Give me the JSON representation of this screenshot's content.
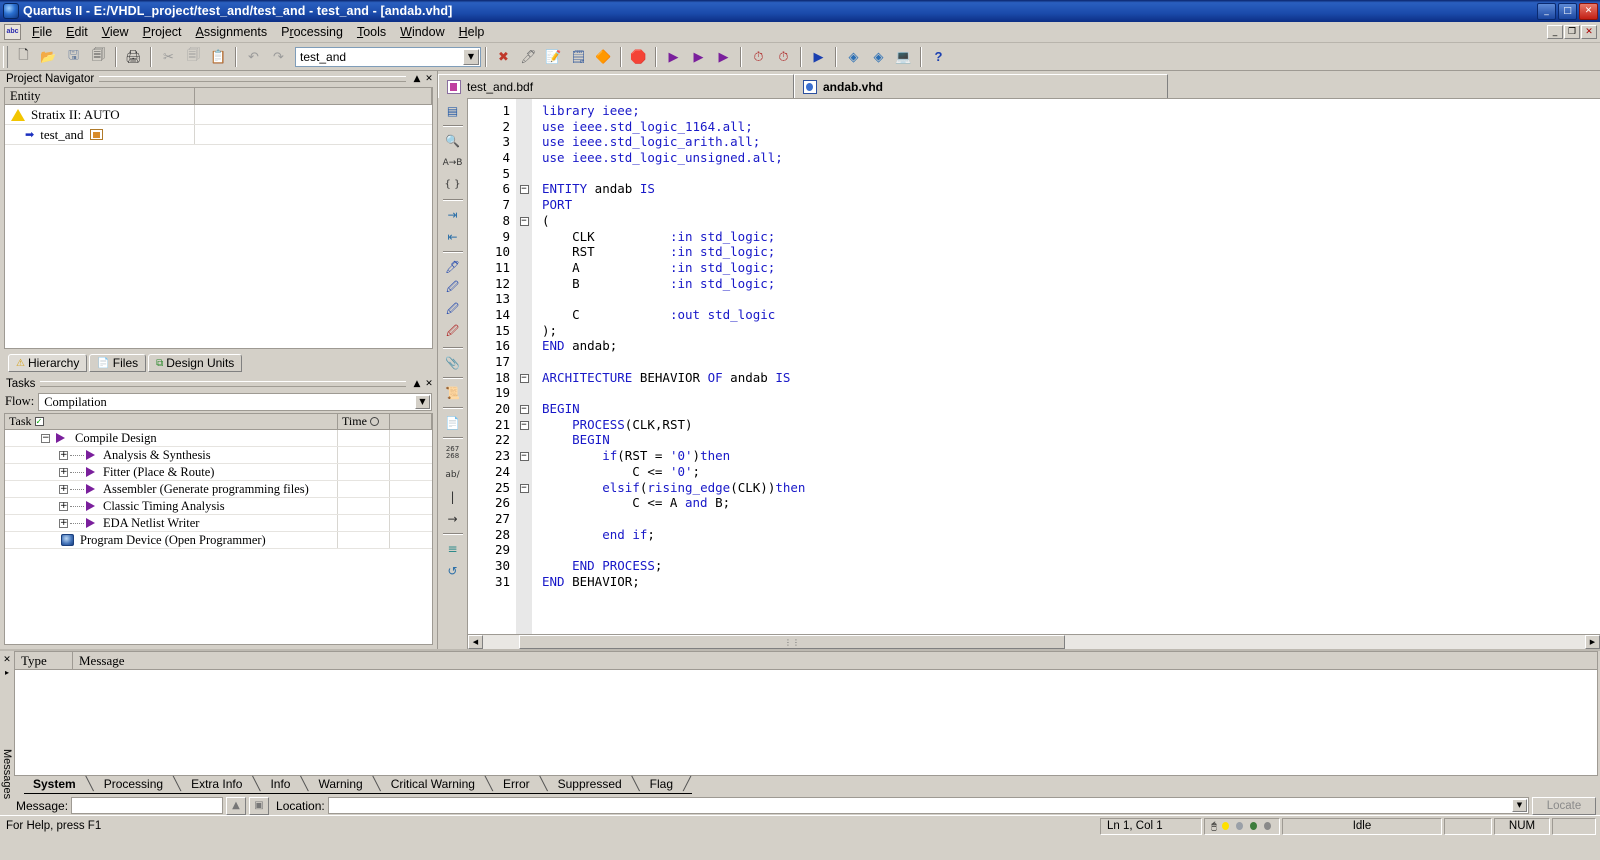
{
  "window": {
    "title": "Quartus II - E:/VHDL_project/test_and/test_and - test_and - [andab.vhd]",
    "app_icon": "quartus-logo-icon",
    "minimize": "_",
    "maximize": "□",
    "close": "✕"
  },
  "menubar": {
    "app_icon": "abc-icon",
    "items": [
      {
        "label": "File"
      },
      {
        "label": "Edit"
      },
      {
        "label": "View"
      },
      {
        "label": "Project"
      },
      {
        "label": "Assignments"
      },
      {
        "label": "Processing"
      },
      {
        "label": "Tools"
      },
      {
        "label": "Window"
      },
      {
        "label": "Help"
      }
    ],
    "mdi": {
      "minimize": "_",
      "restore": "❐",
      "close": "✕"
    }
  },
  "toolbar": {
    "buttons": [
      {
        "name": "new-file-icon",
        "glyph": "🗋"
      },
      {
        "name": "open-file-icon",
        "glyph": "📂"
      },
      {
        "name": "save-file-icon",
        "glyph": "🖫"
      },
      {
        "name": "save-all-icon",
        "glyph": "🗐"
      },
      {
        "name": "print-icon",
        "glyph": "🖨"
      },
      {
        "name": "cut-icon",
        "glyph": "✂"
      },
      {
        "name": "copy-icon",
        "glyph": "🗐"
      },
      {
        "name": "paste-icon",
        "glyph": "📋"
      },
      {
        "name": "undo-icon",
        "glyph": "↶"
      },
      {
        "name": "redo-icon",
        "glyph": "↷"
      }
    ],
    "project_combo": {
      "value": "test_and",
      "arrow": "▼"
    },
    "buttons2": [
      {
        "name": "compilation-report-icon",
        "glyph": "✖"
      },
      {
        "name": "pin-planner-icon",
        "glyph": "🖊"
      },
      {
        "name": "assignment-editor-icon",
        "glyph": "📝"
      },
      {
        "name": "settings-icon",
        "glyph": "🗒"
      },
      {
        "name": "device-icon",
        "glyph": "🔶"
      },
      {
        "name": "stop-icon",
        "glyph": "🛑"
      },
      {
        "name": "start-compilation-icon",
        "glyph": "▶"
      },
      {
        "name": "start-analysis-synthesis-icon",
        "glyph": "▶"
      },
      {
        "name": "start-fitter-icon",
        "glyph": "▶"
      },
      {
        "name": "timing-analyzer-icon",
        "glyph": "⏱"
      },
      {
        "name": "classic-timing-icon",
        "glyph": "⏱"
      },
      {
        "name": "simulation-icon",
        "glyph": "▶"
      },
      {
        "name": "rtl-viewer-icon",
        "glyph": "◈"
      },
      {
        "name": "technology-map-icon",
        "glyph": "◈"
      },
      {
        "name": "programmer-icon",
        "glyph": "💻"
      },
      {
        "name": "help-icon",
        "glyph": "?"
      }
    ]
  },
  "project_navigator": {
    "title": "Project Navigator",
    "collapse": "▲",
    "close": "✕",
    "columns": [
      "Entity",
      ""
    ],
    "rows": [
      {
        "icon": "warning-triangle-icon",
        "label": "Stratix II: AUTO",
        "value": ""
      },
      {
        "icon": "entity-arrow-icon",
        "label": "test_and",
        "value": ""
      }
    ],
    "tabs": [
      {
        "label": "Hierarchy",
        "icon": "hierarchy-icon",
        "active": true
      },
      {
        "label": "Files",
        "icon": "files-icon",
        "active": false
      },
      {
        "label": "Design Units",
        "icon": "design-units-icon",
        "active": false
      }
    ]
  },
  "tasks": {
    "title": "Tasks",
    "collapse": "▲",
    "close": "✕",
    "flow_label": "Flow:",
    "flow_value": "Compilation",
    "flow_arrow": "▼",
    "columns": [
      "Task",
      "Time",
      ""
    ],
    "column_icons": {
      "task": "checkbox-icon",
      "time": "clock-icon"
    },
    "rows": [
      {
        "label": "Compile Design",
        "expander": "−",
        "icon": "play-icon",
        "indent": 0,
        "time": ""
      },
      {
        "label": "Analysis & Synthesis",
        "expander": "+",
        "icon": "play-icon",
        "indent": 1,
        "time": ""
      },
      {
        "label": "Fitter (Place & Route)",
        "expander": "+",
        "icon": "play-icon",
        "indent": 1,
        "time": ""
      },
      {
        "label": "Assembler (Generate programming files)",
        "expander": "+",
        "icon": "play-icon",
        "indent": 1,
        "time": ""
      },
      {
        "label": "Classic Timing Analysis",
        "expander": "+",
        "icon": "play-icon",
        "indent": 1,
        "time": ""
      },
      {
        "label": "EDA Netlist Writer",
        "expander": "+",
        "icon": "play-icon",
        "indent": 1,
        "time": ""
      },
      {
        "label": "Program Device (Open Programmer)",
        "expander": "",
        "icon": "programmer-device-icon",
        "indent": 1,
        "time": ""
      }
    ]
  },
  "editor": {
    "tabs": [
      {
        "label": "test_and.bdf",
        "icon": "bdf-file-icon",
        "active": false
      },
      {
        "label": "andab.vhd",
        "icon": "vhd-file-icon",
        "active": true
      }
    ],
    "vtoolbar": [
      {
        "name": "insert-template-icon",
        "glyph": "▤"
      },
      {
        "name": "find-icon",
        "glyph": "🔍"
      },
      {
        "name": "replace-icon",
        "glyph": "🔤"
      },
      {
        "name": "match-brace-icon",
        "glyph": "{ }"
      },
      {
        "name": "increase-indent-icon",
        "glyph": "⇥"
      },
      {
        "name": "decrease-indent-icon",
        "glyph": "⇤"
      },
      {
        "name": "comment-icon",
        "glyph": "🖊"
      },
      {
        "name": "uncomment-icon",
        "glyph": "🖊"
      },
      {
        "name": "bookmark-toggle-icon",
        "glyph": "🖊"
      },
      {
        "name": "bookmark-clear-icon",
        "glyph": "🖊"
      },
      {
        "name": "attach-icon",
        "glyph": "📎"
      },
      {
        "name": "scroll-lock-icon",
        "glyph": "📜"
      },
      {
        "name": "check-syntax-icon",
        "glyph": "📄"
      },
      {
        "name": "line-numbers-icon",
        "glyph": "267"
      },
      {
        "name": "text-mode-icon",
        "glyph": "ab/"
      },
      {
        "name": "column-select-icon",
        "glyph": "|"
      },
      {
        "name": "goto-line-icon",
        "glyph": "→"
      },
      {
        "name": "align-icon",
        "glyph": "≡"
      },
      {
        "name": "undo-edit-icon",
        "glyph": "↺"
      }
    ],
    "hscroll": {
      "left": "◀",
      "right": "▶",
      "grip": "⋮⋮"
    },
    "lines": [
      {
        "n": "1",
        "fold": "",
        "text": "library ieee;",
        "segs": [
          {
            "t": "library ieee;",
            "c": "k"
          }
        ]
      },
      {
        "n": "2",
        "fold": "",
        "text": "use ieee.std_logic_1164.all;",
        "segs": [
          {
            "t": "use ieee.std_logic_1164.all;",
            "c": "k"
          }
        ]
      },
      {
        "n": "3",
        "fold": "",
        "text": "use ieee.std_logic_arith.all;",
        "segs": [
          {
            "t": "use ieee.std_logic_arith.all;",
            "c": "k"
          }
        ]
      },
      {
        "n": "4",
        "fold": "",
        "text": "use ieee.std_logic_unsigned.all;",
        "segs": [
          {
            "t": "use ieee.std_logic_unsigned.all;",
            "c": "k"
          }
        ]
      },
      {
        "n": "5",
        "fold": "",
        "text": "",
        "segs": []
      },
      {
        "n": "6",
        "fold": "−",
        "text": "ENTITY andab IS",
        "segs": [
          {
            "t": "ENTITY",
            "c": "k"
          },
          {
            "t": " andab ",
            "c": "blk"
          },
          {
            "t": "IS",
            "c": "k"
          }
        ]
      },
      {
        "n": "7",
        "fold": "",
        "text": "PORT",
        "segs": [
          {
            "t": "PORT",
            "c": "k"
          }
        ]
      },
      {
        "n": "8",
        "fold": "−",
        "text": "(",
        "segs": [
          {
            "t": "(",
            "c": "blk"
          }
        ]
      },
      {
        "n": "9",
        "fold": "",
        "text": "    CLK          :in std_logic;",
        "segs": [
          {
            "t": "    CLK          ",
            "c": "blk"
          },
          {
            "t": ":in std_logic;",
            "c": "k"
          }
        ]
      },
      {
        "n": "10",
        "fold": "",
        "text": "    RST          :in std_logic;",
        "segs": [
          {
            "t": "    RST          ",
            "c": "blk"
          },
          {
            "t": ":in std_logic;",
            "c": "k"
          }
        ]
      },
      {
        "n": "11",
        "fold": "",
        "text": "    A            :in std_logic;",
        "segs": [
          {
            "t": "    A            ",
            "c": "blk"
          },
          {
            "t": ":in std_logic;",
            "c": "k"
          }
        ]
      },
      {
        "n": "12",
        "fold": "",
        "text": "    B            :in std_logic;",
        "segs": [
          {
            "t": "    B            ",
            "c": "blk"
          },
          {
            "t": ":in std_logic;",
            "c": "k"
          }
        ]
      },
      {
        "n": "13",
        "fold": "",
        "text": "",
        "segs": []
      },
      {
        "n": "14",
        "fold": "",
        "text": "    C            :out std_logic",
        "segs": [
          {
            "t": "    C            ",
            "c": "blk"
          },
          {
            "t": ":out std_logic",
            "c": "k"
          }
        ]
      },
      {
        "n": "15",
        "fold": "",
        "text": ");",
        "segs": [
          {
            "t": ");",
            "c": "blk"
          }
        ]
      },
      {
        "n": "16",
        "fold": "",
        "text": "END andab;",
        "segs": [
          {
            "t": "END",
            "c": "k"
          },
          {
            "t": " andab;",
            "c": "blk"
          }
        ]
      },
      {
        "n": "17",
        "fold": "",
        "text": "",
        "segs": []
      },
      {
        "n": "18",
        "fold": "−",
        "text": "ARCHITECTURE BEHAVIOR OF andab IS",
        "segs": [
          {
            "t": "ARCHITECTURE",
            "c": "k"
          },
          {
            "t": " BEHAVIOR ",
            "c": "blk"
          },
          {
            "t": "OF",
            "c": "k"
          },
          {
            "t": " andab ",
            "c": "blk"
          },
          {
            "t": "IS",
            "c": "k"
          }
        ]
      },
      {
        "n": "19",
        "fold": "",
        "text": "",
        "segs": []
      },
      {
        "n": "20",
        "fold": "−",
        "text": "BEGIN",
        "segs": [
          {
            "t": "BEGIN",
            "c": "k"
          }
        ]
      },
      {
        "n": "21",
        "fold": "−",
        "text": "    PROCESS(CLK,RST)",
        "segs": [
          {
            "t": "    ",
            "c": "blk"
          },
          {
            "t": "PROCESS",
            "c": "k"
          },
          {
            "t": "(CLK,RST)",
            "c": "blk"
          }
        ]
      },
      {
        "n": "22",
        "fold": "",
        "text": "    BEGIN",
        "segs": [
          {
            "t": "    ",
            "c": "blk"
          },
          {
            "t": "BEGIN",
            "c": "k"
          }
        ]
      },
      {
        "n": "23",
        "fold": "−",
        "text": "        if(RST = '0')then",
        "segs": [
          {
            "t": "        ",
            "c": "blk"
          },
          {
            "t": "if",
            "c": "k"
          },
          {
            "t": "(RST = ",
            "c": "blk"
          },
          {
            "t": "'0'",
            "c": "k"
          },
          {
            "t": ")",
            "c": "blk"
          },
          {
            "t": "then",
            "c": "k"
          }
        ]
      },
      {
        "n": "24",
        "fold": "",
        "text": "            C <= '0';",
        "segs": [
          {
            "t": "            C <= ",
            "c": "blk"
          },
          {
            "t": "'0'",
            "c": "k"
          },
          {
            "t": ";",
            "c": "blk"
          }
        ]
      },
      {
        "n": "25",
        "fold": "−",
        "text": "        elsif(rising_edge(CLK))then",
        "segs": [
          {
            "t": "        ",
            "c": "blk"
          },
          {
            "t": "elsif",
            "c": "k"
          },
          {
            "t": "(",
            "c": "blk"
          },
          {
            "t": "rising_edge",
            "c": "k"
          },
          {
            "t": "(CLK))",
            "c": "blk"
          },
          {
            "t": "then",
            "c": "k"
          }
        ]
      },
      {
        "n": "26",
        "fold": "",
        "text": "            C <= A and B;",
        "segs": [
          {
            "t": "            C <= A ",
            "c": "blk"
          },
          {
            "t": "and",
            "c": "k"
          },
          {
            "t": " B;",
            "c": "blk"
          }
        ]
      },
      {
        "n": "27",
        "fold": "",
        "text": "",
        "segs": []
      },
      {
        "n": "28",
        "fold": "",
        "text": "        end if;",
        "segs": [
          {
            "t": "        ",
            "c": "blk"
          },
          {
            "t": "end if",
            "c": "k"
          },
          {
            "t": ";",
            "c": "blk"
          }
        ]
      },
      {
        "n": "29",
        "fold": "",
        "text": "",
        "segs": []
      },
      {
        "n": "30",
        "fold": "",
        "text": "    END PROCESS;",
        "segs": [
          {
            "t": "    ",
            "c": "blk"
          },
          {
            "t": "END PROCESS",
            "c": "k"
          },
          {
            "t": ";",
            "c": "blk"
          }
        ]
      },
      {
        "n": "31",
        "fold": "",
        "text": "END BEHAVIOR;",
        "segs": [
          {
            "t": "END",
            "c": "k"
          },
          {
            "t": " BEHAVIOR;",
            "c": "blk"
          }
        ]
      }
    ]
  },
  "messages": {
    "close": "✕",
    "pin": "▸",
    "vertical_label": "Messages",
    "columns": [
      "Type",
      "Message"
    ],
    "rows": [],
    "tabs": [
      {
        "label": "System",
        "active": true
      },
      {
        "label": "Processing",
        "active": false
      },
      {
        "label": "Extra Info",
        "active": false
      },
      {
        "label": "Info",
        "active": false
      },
      {
        "label": "Warning",
        "active": false
      },
      {
        "label": "Critical Warning",
        "active": false
      },
      {
        "label": "Error",
        "active": false
      },
      {
        "label": "Suppressed",
        "active": false
      },
      {
        "label": "Flag",
        "active": false
      }
    ],
    "bar": {
      "message_label": "Message:",
      "message_value": "",
      "location_label": "Location:",
      "location_value": "",
      "up_icon": "▲",
      "find_icon": "▣",
      "dropdown_arrow": "▼",
      "locate_button": "Locate"
    }
  },
  "statusbar": {
    "help_text": "For Help, press F1",
    "cursor": "Ln 1, Col 1",
    "state": "Idle",
    "num_lock": "NUM",
    "leds": [
      "#ffe000",
      "#9aa0a8",
      "#3d7d3d",
      "#8a8a8a"
    ]
  },
  "colors": {
    "title_bar": "#0a246a",
    "face": "#d4d0c8",
    "keyword": "#1818c8",
    "accent_purple": "#7a1f9c"
  }
}
